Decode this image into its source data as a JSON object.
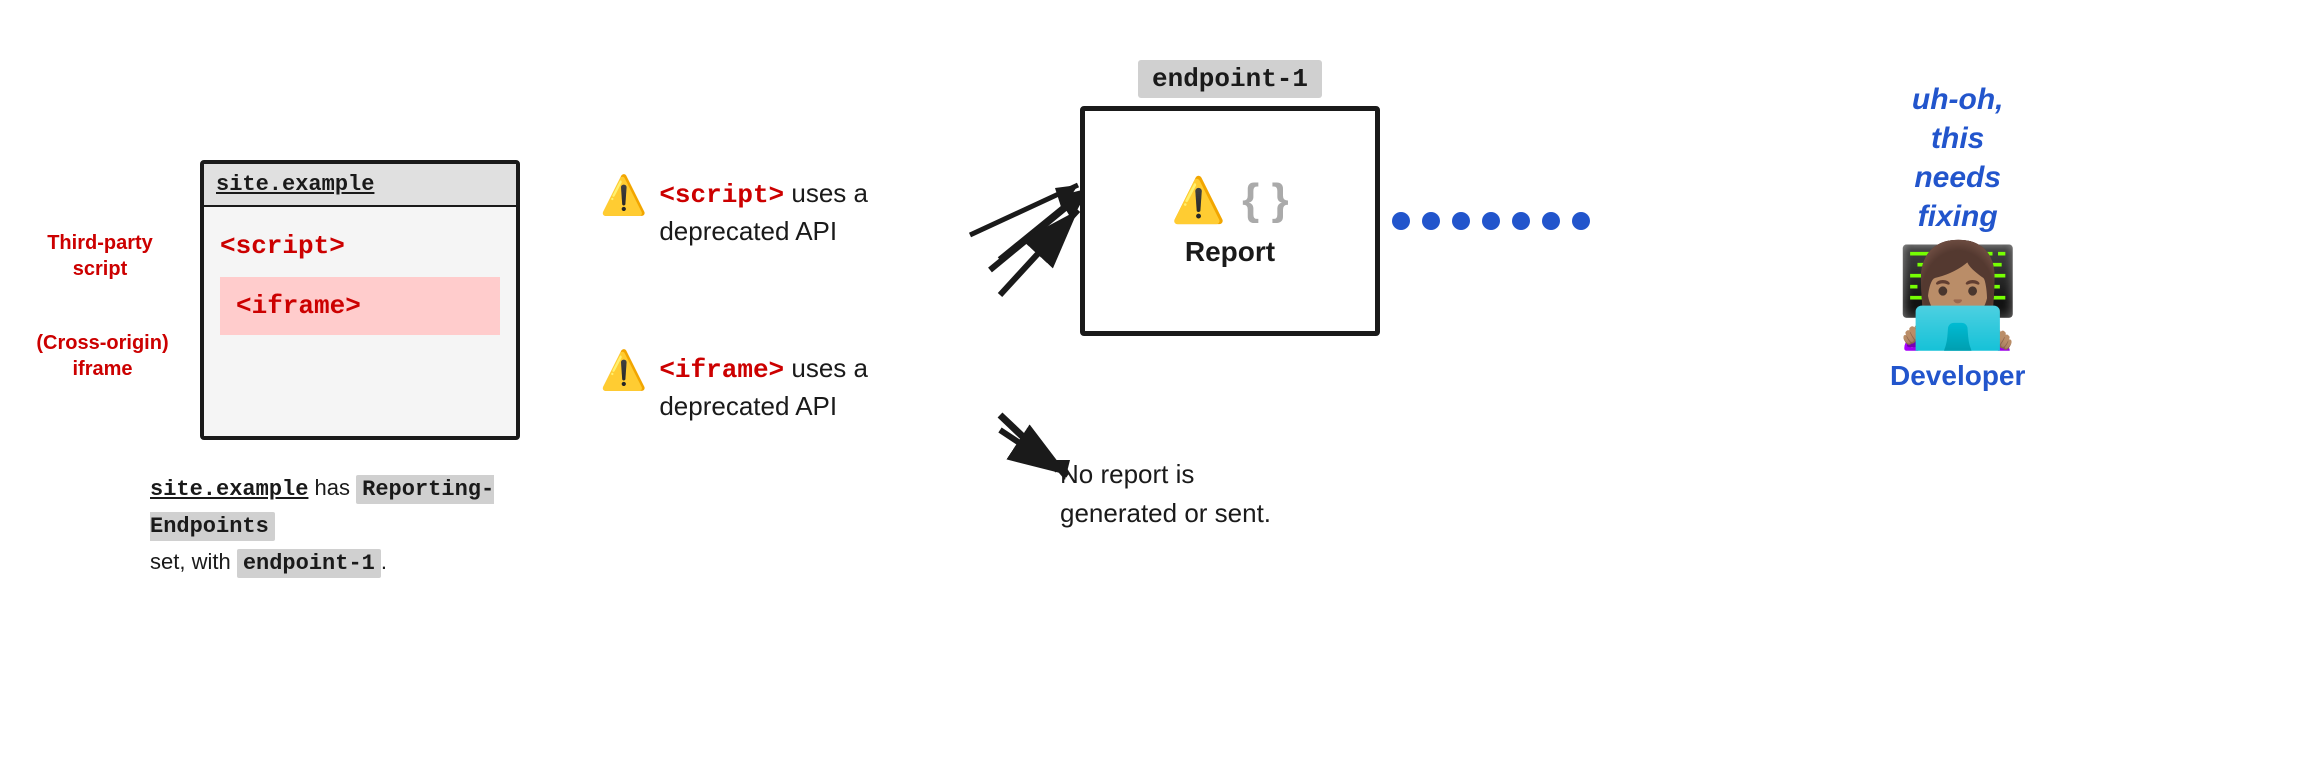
{
  "site_box": {
    "title": "site.example",
    "script_tag": "<script>",
    "iframe_tag": "<iframe>"
  },
  "labels": {
    "third_party": "Third-party\nscript",
    "cross_origin": "(Cross-origin)\niframe"
  },
  "bottom_text": {
    "part1": "site.example",
    "part2": " has",
    "part3": "Reporting-Endpoints",
    "part4": "set, with",
    "endpoint_ref": "endpoint-1",
    "part5": "."
  },
  "warnings": [
    {
      "id": "warning-script",
      "tag": "<script>",
      "text": " uses a\ndeprecated API"
    },
    {
      "id": "warning-iframe",
      "tag": "<iframe>",
      "text": " uses a\ndeprecated API"
    }
  ],
  "endpoint": {
    "label": "endpoint-1",
    "report_text": "Report"
  },
  "no_report": {
    "text": "No report is\ngenerated or sent."
  },
  "developer": {
    "uh_oh": "uh-oh,\nthis\nneeds\nfixing",
    "label": "Developer"
  },
  "arrows": {
    "up_arrow": "↗",
    "down_arrow": "↘"
  }
}
